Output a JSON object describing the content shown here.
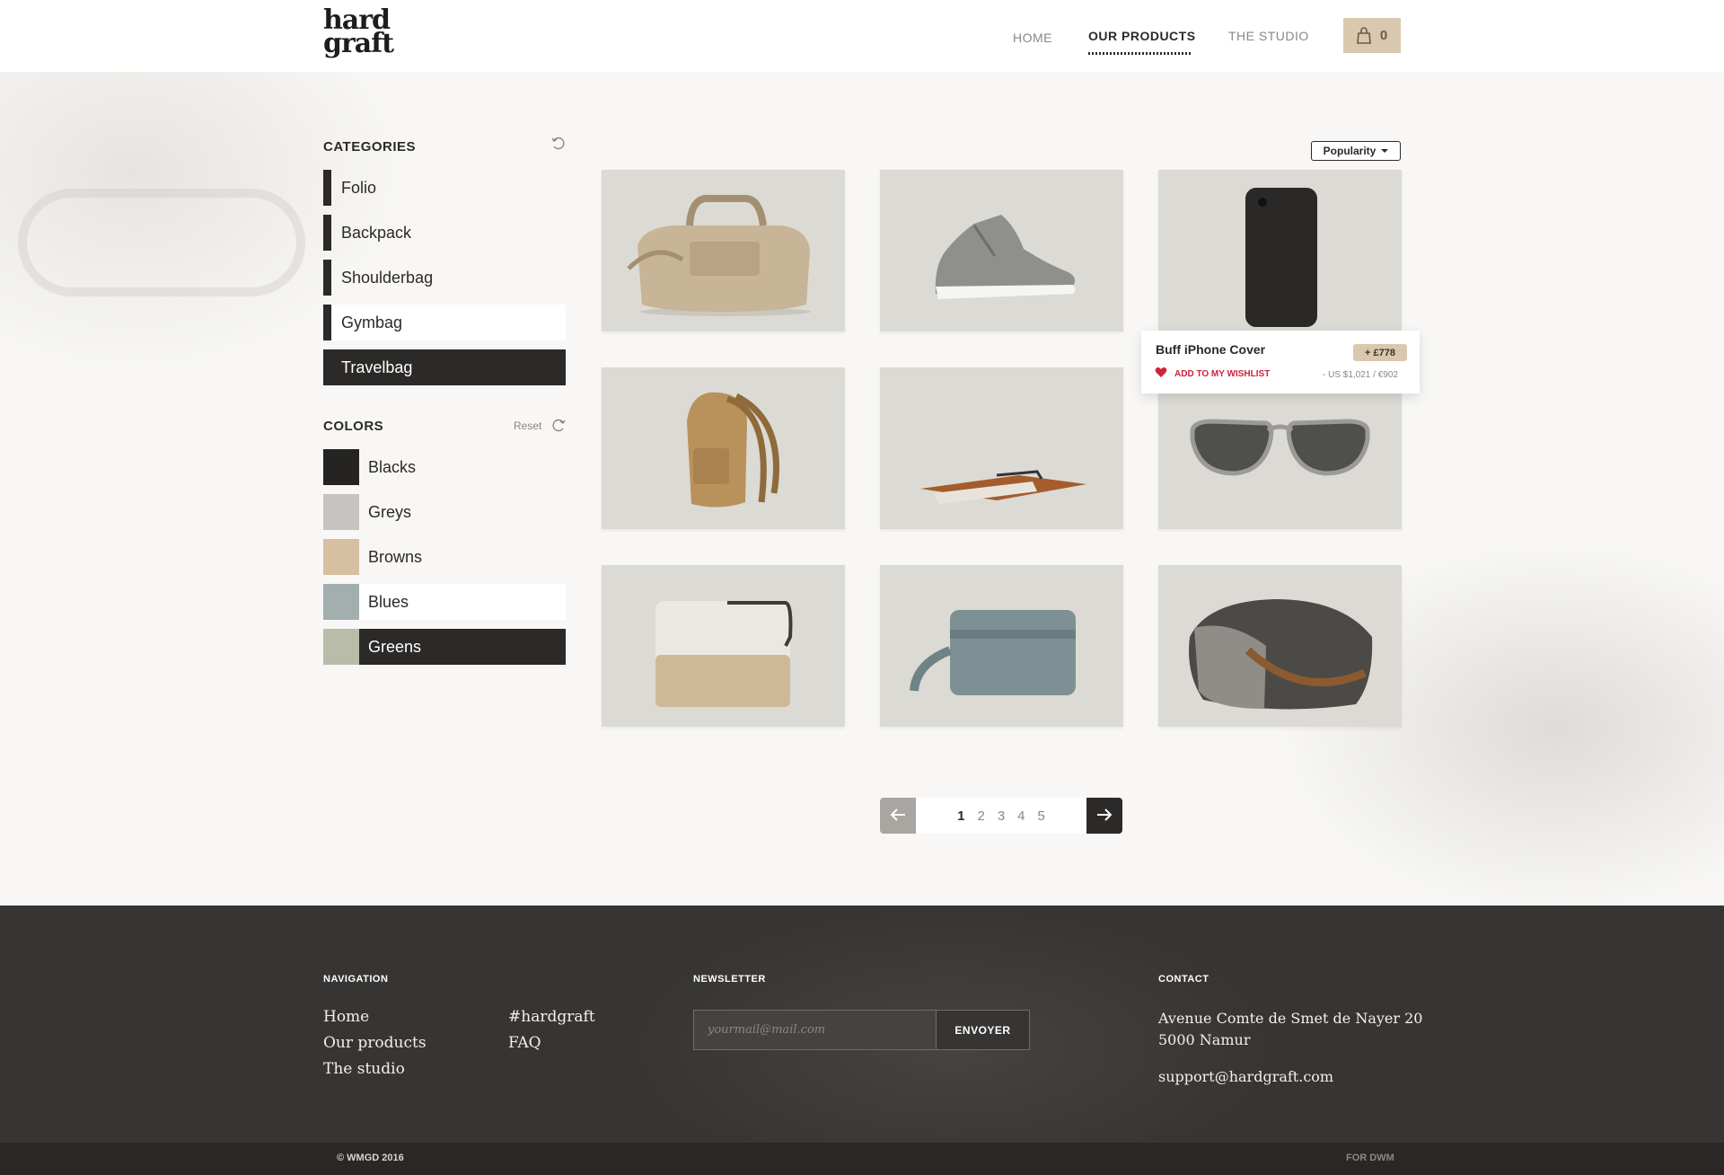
{
  "header": {
    "logo_line1": "hard",
    "logo_line2": "graft",
    "nav": [
      {
        "label": "HOME"
      },
      {
        "label": "OUR PRODUCTS"
      },
      {
        "label": "THE STUDIO"
      }
    ],
    "cart_count": "0"
  },
  "sidebar": {
    "categories_heading": "CATEGORIES",
    "categories": [
      {
        "label": "Folio"
      },
      {
        "label": "Backpack"
      },
      {
        "label": "Shoulderbag"
      },
      {
        "label": "Gymbag"
      },
      {
        "label": "Travelbag"
      }
    ],
    "colors_heading": "COLORS",
    "colors_reset": "Reset",
    "colors": [
      {
        "label": "Blacks",
        "swatch": "#262422"
      },
      {
        "label": "Greys",
        "swatch": "#c6c4c1"
      },
      {
        "label": "Browns",
        "swatch": "#d7c0a2"
      },
      {
        "label": "Blues",
        "swatch": "#a3aeae"
      },
      {
        "label": "Greens",
        "swatch": "#b9bca8"
      }
    ]
  },
  "sort": {
    "label": "Popularity"
  },
  "products": [
    {
      "name": "duffel-bag",
      "icon": "duffel-bag-icon"
    },
    {
      "name": "sneaker",
      "icon": "sneaker-icon"
    },
    {
      "name": "iphone-cover",
      "icon": "phone-case-icon"
    },
    {
      "name": "backpack",
      "icon": "backpack-icon"
    },
    {
      "name": "wallet",
      "icon": "wallet-icon"
    },
    {
      "name": "sunglasses",
      "icon": "sunglasses-icon"
    },
    {
      "name": "laptop-sleeve",
      "icon": "laptop-sleeve-icon"
    },
    {
      "name": "toiletry-bag",
      "icon": "pouch-icon"
    },
    {
      "name": "shoulder-bag",
      "icon": "shoulder-bag-icon"
    }
  ],
  "tooltip": {
    "name": "Buff iPhone Cover",
    "price": "+ £778",
    "wishlist": "ADD TO MY WISHLIST",
    "alt_price": "- US $1,021 / €902"
  },
  "pagination": {
    "pages": [
      "1",
      "2",
      "3",
      "4",
      "5"
    ],
    "current": "1"
  },
  "footer": {
    "navigation_heading": "NAVIGATION",
    "nav_col1": [
      "Home",
      "Our products",
      "The studio"
    ],
    "nav_col2": [
      "#hardgraft",
      "FAQ"
    ],
    "newsletter_heading": "NEWSLETTER",
    "newsletter_placeholder": "yourmail@mail.com",
    "newsletter_button": "ENVOYER",
    "contact_heading": "CONTACT",
    "address_line1": "Avenue Comte de Smet de Nayer 20",
    "address_line2": "5000 Namur",
    "email": "support@hardgraft.com",
    "copyright": "© WMGD 2016",
    "credit": "FOR DWM"
  }
}
